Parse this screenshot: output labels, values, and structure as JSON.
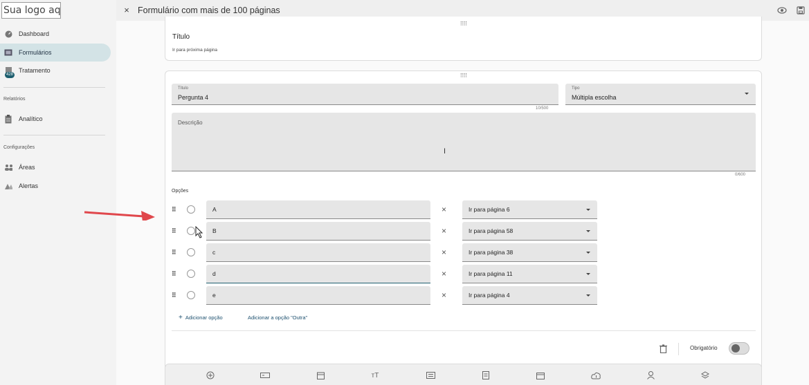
{
  "logo": {
    "text": "Sua logo aqui"
  },
  "sidebar": {
    "items": [
      {
        "label": "Dashboard",
        "icon": "dashboard-icon"
      },
      {
        "label": "Formulários",
        "icon": "forms-icon",
        "active": true
      },
      {
        "label": "Tratamento",
        "icon": "treatment-icon",
        "badge": "428"
      }
    ],
    "sections": [
      {
        "label": "Relatórios",
        "items": [
          {
            "label": "Analítico",
            "icon": "clipboard-icon"
          }
        ]
      },
      {
        "label": "Configurações",
        "items": [
          {
            "label": "Áreas",
            "icon": "people-icon"
          },
          {
            "label": "Alertas",
            "icon": "alert-icon"
          }
        ]
      }
    ]
  },
  "topbar": {
    "title": "Formulário com mais de 100 páginas",
    "close": "×"
  },
  "page_break": {
    "title": "Título",
    "subtitle": "Ir para próxima página"
  },
  "question": {
    "title_label": "Título",
    "title_value": "Pergunta 4",
    "title_counter": "10/500",
    "type_label": "Tipo",
    "type_value": "Múltipla escolha",
    "description_placeholder": "Descrição",
    "description_counter": "0/600",
    "options_label": "Opções",
    "options": [
      {
        "value": "A",
        "goto": "Ir para página 6"
      },
      {
        "value": "B",
        "goto": "Ir para página 58"
      },
      {
        "value": "c",
        "goto": "Ir para página 38"
      },
      {
        "value": "d",
        "goto": "Ir para página 11"
      },
      {
        "value": "e",
        "goto": "Ir para página 4"
      }
    ],
    "add_option": "Adicionar opção",
    "add_other": "Adicionar a opção \"Outra\"",
    "required_label": "Obrigatório"
  },
  "colors": {
    "accent": "#1d5e6e",
    "active_bg": "#d3e3e6",
    "arrow": "#e0474c"
  }
}
